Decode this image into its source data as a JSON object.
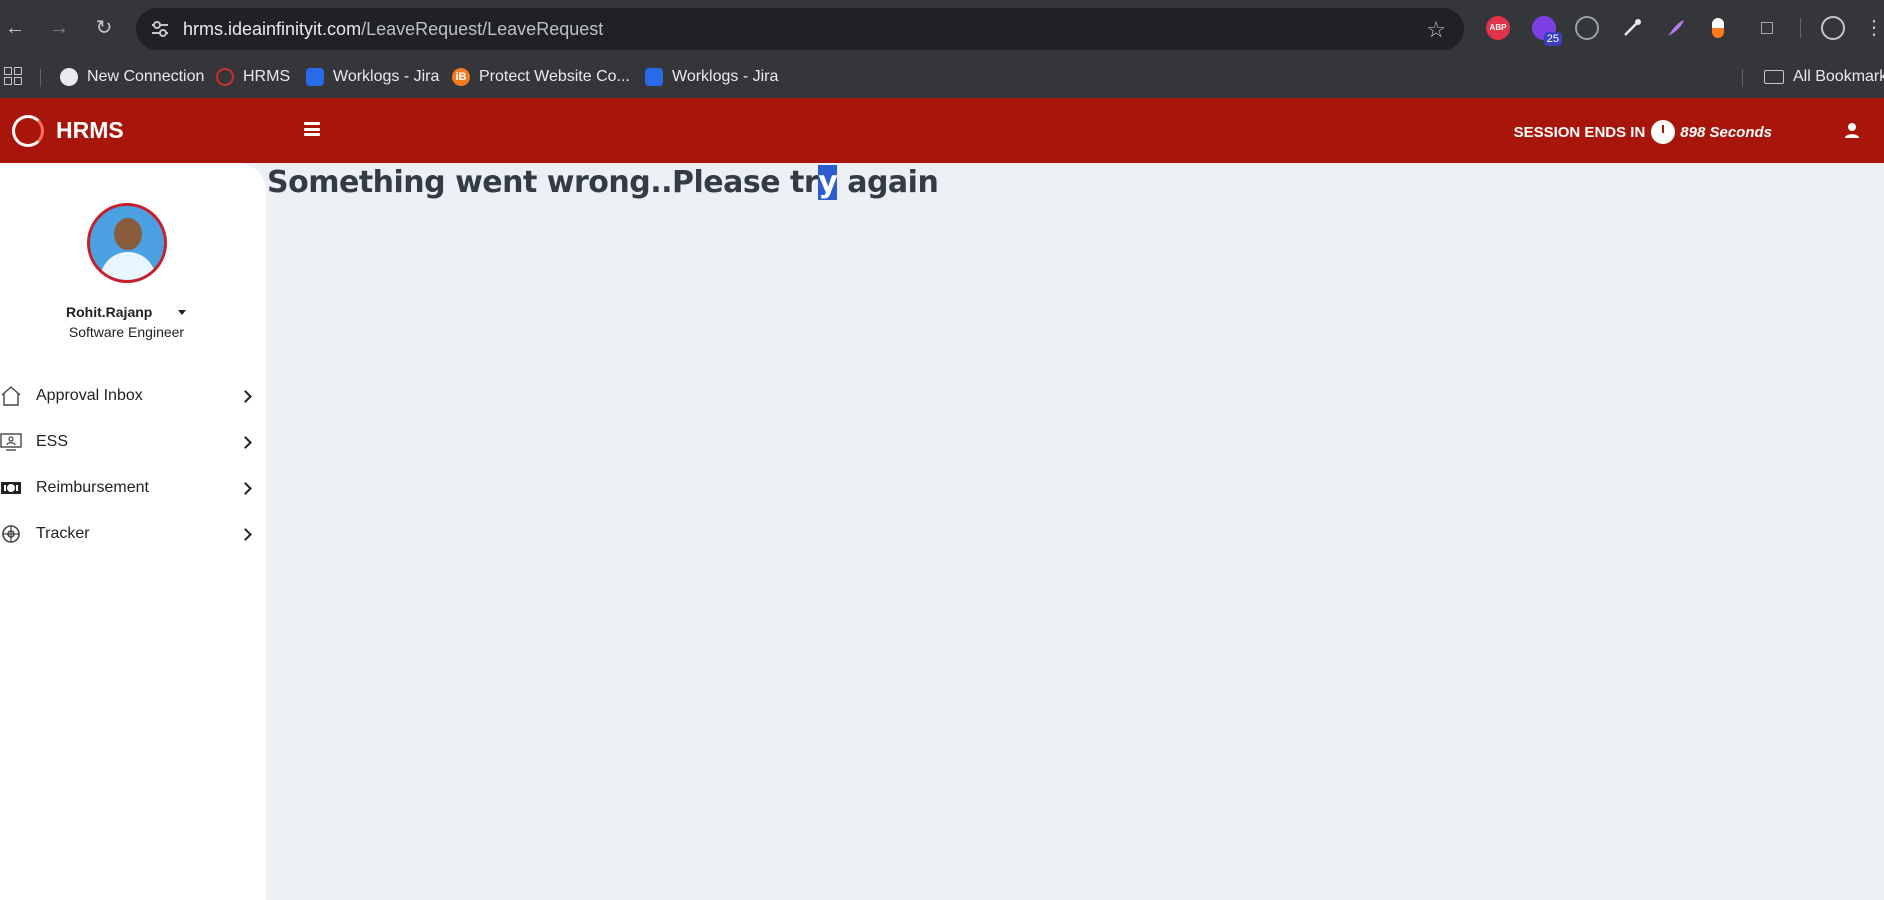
{
  "browser": {
    "url_host": "hrms.ideainfinityit.com",
    "url_path": "/LeaveRequest/LeaveRequest",
    "extensions": {
      "abp_label": "ABP",
      "badge_count": "25"
    }
  },
  "bookmarks": {
    "items": [
      {
        "label": "New Connection",
        "icon": "globe-icon"
      },
      {
        "label": "HRMS",
        "icon": "hrms-logo-icon"
      },
      {
        "label": "Worklogs - Jira",
        "icon": "jira-icon"
      },
      {
        "label": "Protect Website Co...",
        "icon": "ib-icon"
      },
      {
        "label": "Worklogs - Jira",
        "icon": "jira-icon"
      }
    ],
    "all_bookmarks_label": "All Bookmarks"
  },
  "header": {
    "brand": "HRMS",
    "session_label": "SESSION ENDS IN",
    "session_seconds": "898 Seconds"
  },
  "sidebar": {
    "user_name": "Rohit.Rajanp",
    "user_role": "Software Engineer",
    "items": [
      {
        "label": "Approval Inbox",
        "icon": "home-icon"
      },
      {
        "label": "ESS",
        "icon": "monitor-user-icon"
      },
      {
        "label": "Reimbursement",
        "icon": "cash-icon"
      },
      {
        "label": "Tracker",
        "icon": "gear-icon"
      }
    ]
  },
  "main": {
    "error_before": "Something went wrong..Please tr",
    "error_selected": "y",
    "error_after": " again"
  },
  "colors": {
    "header_red": "#a8160b",
    "content_bg": "#eceff3",
    "selection_blue": "#2d5bd0"
  }
}
